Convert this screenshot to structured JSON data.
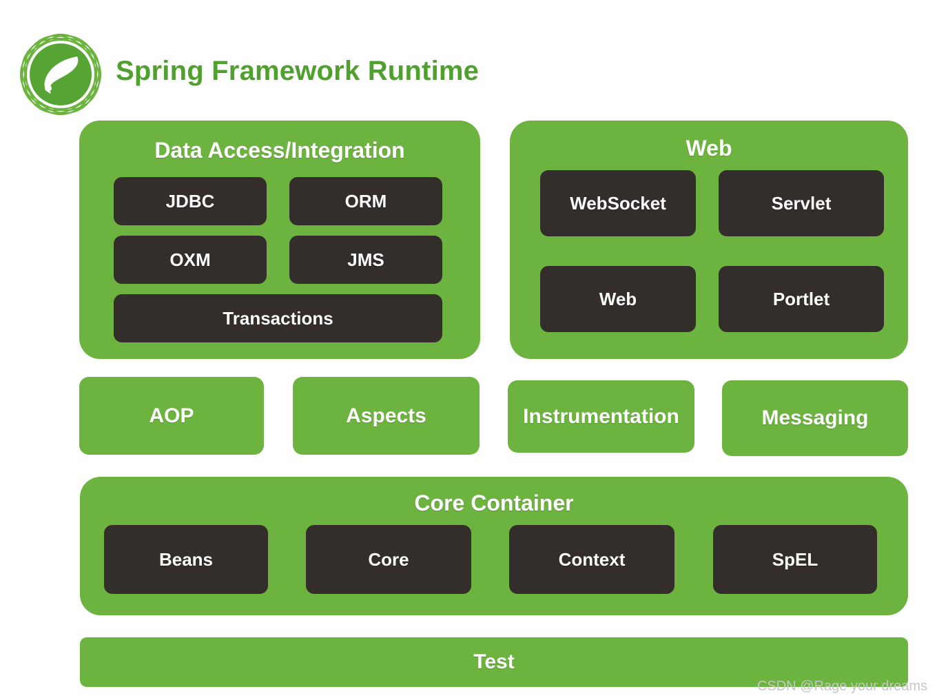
{
  "header": {
    "title": "Spring Framework Runtime",
    "logo_icon": "spring-leaf-logo-icon",
    "title_color": "#4FA12E"
  },
  "theme": {
    "green": "#6CB33F",
    "dark": "#332E2B",
    "text_on_dark": "#FFFFFF",
    "background": "#FFFFFF",
    "watermark_color": "#C6C6C6"
  },
  "panels": {
    "data_access": {
      "title": "Data Access/Integration",
      "modules": [
        {
          "label": "JDBC"
        },
        {
          "label": "ORM"
        },
        {
          "label": "OXM"
        },
        {
          "label": "JMS"
        },
        {
          "label": "Transactions"
        }
      ]
    },
    "web": {
      "title": "Web",
      "modules": [
        {
          "label": "WebSocket"
        },
        {
          "label": "Servlet"
        },
        {
          "label": "Web"
        },
        {
          "label": "Portlet"
        }
      ]
    },
    "core_container": {
      "title": "Core Container",
      "modules": [
        {
          "label": "Beans"
        },
        {
          "label": "Core"
        },
        {
          "label": "Context"
        },
        {
          "label": "SpEL"
        }
      ]
    }
  },
  "middle_row": [
    {
      "label": "AOP"
    },
    {
      "label": "Aspects"
    },
    {
      "label": "Instrumentation"
    },
    {
      "label": "Messaging"
    }
  ],
  "test_bar": {
    "label": "Test"
  },
  "watermark": {
    "text": "CSDN @Rage your dreams"
  }
}
